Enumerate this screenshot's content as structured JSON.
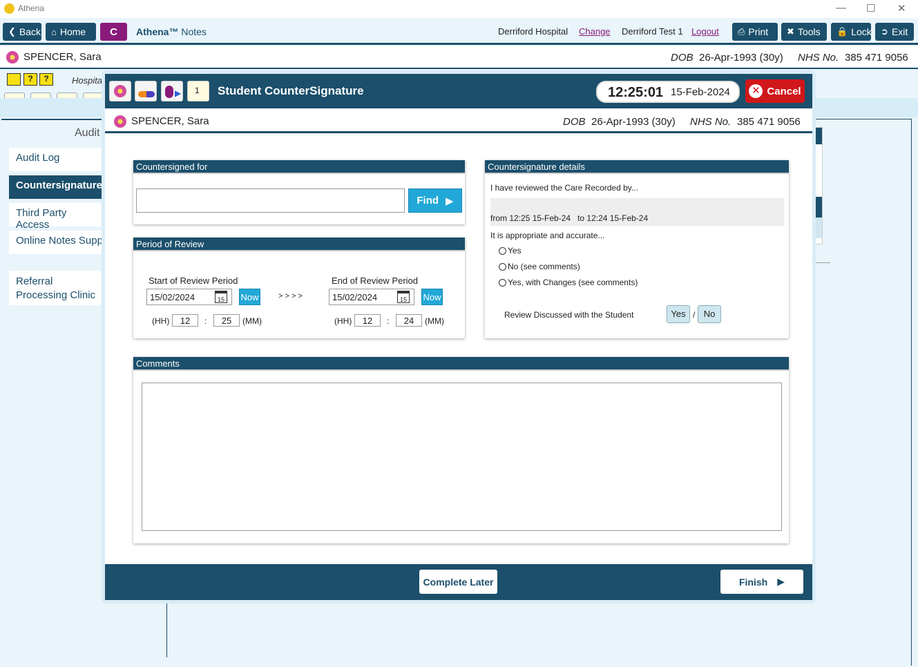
{
  "window": {
    "title": "Athena"
  },
  "nav": {
    "back": "Back",
    "home": "Home",
    "c_label": "C",
    "brand": "Athena™",
    "brand_sub": "Notes",
    "hospital": "Derriford Hospital",
    "change": "Change",
    "user": "Derriford Test 1",
    "logout": "Logout",
    "print": "Print",
    "tools": "Tools",
    "lock": "Lock",
    "exit": "Exit"
  },
  "patient": {
    "name": "SPENCER, Sara",
    "dob_label": "DOB",
    "dob": "26-Apr-1993 (30y)",
    "nhs_label": "NHS No.",
    "nhs": "385 471 9056"
  },
  "background": {
    "hospital_partial": "Hospita",
    "audit_heading": "Audit",
    "sidebar": [
      {
        "label": "Audit Log",
        "active": false
      },
      {
        "label": "Countersignature",
        "active": true
      },
      {
        "label": "Third Party Access",
        "active": false
      },
      {
        "label": "Online Notes Supp",
        "active": false
      },
      {
        "label": "Referral Processing Clinic",
        "active": false
      }
    ]
  },
  "modal": {
    "title": "Student CounterSignature",
    "time": "12:25:01",
    "date": "15-Feb-2024",
    "cancel": "Cancel",
    "countersigned_for": {
      "heading": "Countersigned for",
      "value": "",
      "find": "Find"
    },
    "period": {
      "heading": "Period of Review",
      "start_label": "Start of Review Period",
      "end_label": "End of Review Period",
      "start_date": "15/02/2024",
      "end_date": "15/02/2024",
      "cal_day": "15",
      "now": "Now",
      "arrows": "> > > >",
      "hh": "(HH)",
      "mm": "(MM)",
      "colon": ":",
      "start_hh": "12",
      "start_mm": "25",
      "end_hh": "12",
      "end_mm": "24"
    },
    "details": {
      "heading": "Countersignature details",
      "reviewed": "I have reviewed the Care Recorded by...",
      "range": "from 12:25 15-Feb-24   to 12:24 15-Feb-24",
      "appropriate": "It is appropriate and accurate...",
      "options": [
        "Yes",
        "No (see comments)",
        "Yes, with Changes (see comments)"
      ],
      "discussed": "Review Discussed with the Student",
      "yes": "Yes",
      "slash": "/",
      "no": "No"
    },
    "comments": {
      "heading": "Comments",
      "value": ""
    },
    "complete_later": "Complete Later",
    "finish": "Finish"
  },
  "colors": {
    "primary": "#1b4f6b",
    "accent": "#22a8d8",
    "cancel": "#d0171b",
    "brand": "#8a1a7a"
  }
}
